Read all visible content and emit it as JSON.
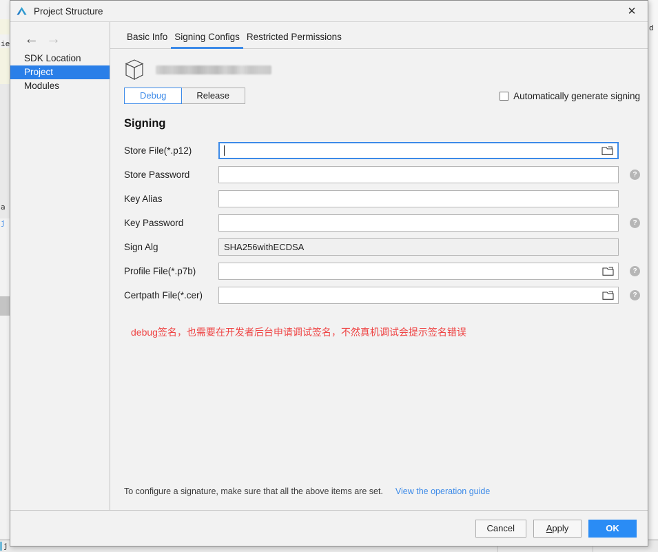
{
  "window": {
    "title": "Project Structure",
    "logo_icon": "devecostudio-logo-icon",
    "close_icon": "close-icon"
  },
  "sidebar": {
    "back_icon": "arrow-left-icon",
    "forward_icon": "arrow-right-icon",
    "items": [
      {
        "label": "SDK Location",
        "selected": false
      },
      {
        "label": "Project",
        "selected": true
      },
      {
        "label": "Modules",
        "selected": false
      }
    ]
  },
  "tabs": [
    {
      "label": "Basic Info",
      "active": false
    },
    {
      "label": "Signing Configs",
      "active": true
    },
    {
      "label": "Restricted Permissions",
      "active": false
    }
  ],
  "module": {
    "icon": "cube-module-icon",
    "name_redacted": ""
  },
  "variants": {
    "options": [
      {
        "label": "Debug",
        "active": true
      },
      {
        "label": "Release",
        "active": false
      }
    ]
  },
  "auto_sign": {
    "label": "Automatically generate signing",
    "checked": false,
    "checkbox_icon": "checkbox-unchecked-icon"
  },
  "signing": {
    "heading": "Signing",
    "fields": [
      {
        "label": "Store File(*.p12)",
        "value": "",
        "focused": true,
        "readonly": false,
        "browse_icon": "folder-browse-icon",
        "has_browse": true,
        "has_help": false
      },
      {
        "label": "Store Password",
        "value": "",
        "focused": false,
        "readonly": false,
        "has_browse": false,
        "has_help": true,
        "help_icon": "help-question-icon"
      },
      {
        "label": "Key Alias",
        "value": "",
        "focused": false,
        "readonly": false,
        "has_browse": false,
        "has_help": false
      },
      {
        "label": "Key Password",
        "value": "",
        "focused": false,
        "readonly": false,
        "has_browse": false,
        "has_help": true,
        "help_icon": "help-question-icon"
      },
      {
        "label": "Sign Alg",
        "value": "SHA256withECDSA",
        "focused": false,
        "readonly": true,
        "has_browse": false,
        "has_help": false
      },
      {
        "label": "Profile File(*.p7b)",
        "value": "",
        "focused": false,
        "readonly": false,
        "browse_icon": "folder-browse-icon",
        "has_browse": true,
        "has_help": true,
        "help_icon": "help-question-icon"
      },
      {
        "label": "Certpath File(*.cer)",
        "value": "",
        "focused": false,
        "readonly": false,
        "browse_icon": "folder-browse-icon",
        "has_browse": true,
        "has_help": true,
        "help_icon": "help-question-icon"
      }
    ]
  },
  "warning": {
    "text": "debug签名，也需要在开发者后台申请调试签名，不然真机调试会提示签名错误",
    "color": "#ef4444"
  },
  "footer": {
    "note": "To configure a signature, make sure that all the above items are set.",
    "link": "View the operation guide",
    "link_color": "#3c8ae8"
  },
  "buttons": {
    "cancel": "Cancel",
    "apply_mnemonic": "A",
    "apply_rest": "pply",
    "ok": "OK",
    "ok_color": "#2a8cf5"
  },
  "background": {
    "left_fragments": [
      "ie",
      "a",
      "j",
      "j"
    ],
    "right_fragment": "d",
    "bottom_fragment": "j"
  },
  "theme": {
    "accent": "#3c8ae8",
    "selection": "#2a7fe8",
    "dialog_bg": "#f2f2f2"
  }
}
